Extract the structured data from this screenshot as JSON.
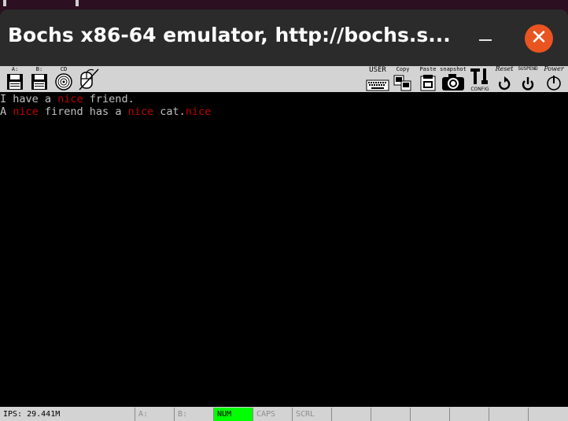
{
  "window": {
    "title": "Bochs x86-64 emulator, http://bochs.s..."
  },
  "toolbar": {
    "drive_a": "A:",
    "drive_b": "B:",
    "cdrom": "CD",
    "user": "USER",
    "copy": "Copy",
    "paste": "Paste",
    "snapshot": "snapshot",
    "config": "CONFIG",
    "reset": "Reset",
    "suspend": "SUSPEND",
    "power": "Power"
  },
  "screen": {
    "line1": {
      "a": "I have a ",
      "b": "nice",
      "c": " friend."
    },
    "line2": {
      "a": "A ",
      "b": "nice",
      "c": " firend has a ",
      "d": "nice",
      "e": " cat.",
      "f": "nice"
    }
  },
  "status": {
    "ips": "IPS: 29.441M",
    "a": "A:",
    "b": "B:",
    "num": "NUM",
    "caps": "CAPS",
    "scrl": "SCRL"
  },
  "colors": {
    "highlight_text": "#c00000",
    "num_active": "#00ff00",
    "close": "#e95420"
  },
  "icons": [
    "floppy-a-icon",
    "floppy-b-icon",
    "cdrom-icon",
    "mouse-icon",
    "keyboard-icon",
    "copy-icon",
    "paste-icon",
    "snapshot-icon",
    "config-icon",
    "reset-icon",
    "suspend-icon",
    "power-icon",
    "minimize-icon",
    "close-icon"
  ]
}
